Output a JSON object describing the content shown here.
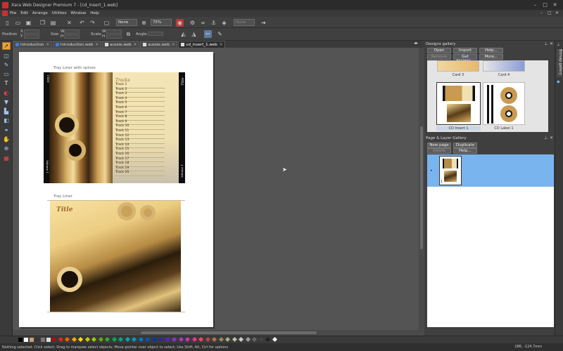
{
  "window": {
    "title": "Xara Web Designer Premium 7 - [cd_insert_1.web]"
  },
  "menu": [
    "File",
    "Edit",
    "Arrange",
    "Utilities",
    "Window",
    "Help"
  ],
  "toolbar": {
    "quality_value": "None",
    "zoom_value": "75%",
    "transparency_value": "None"
  },
  "infobar": {
    "position_label": "Position",
    "size_label": "Size",
    "scale_label": "Scale",
    "angle_label": "Angle",
    "x_label": "X",
    "y_label": "Y",
    "w_label": "W",
    "h_label": "H"
  },
  "tabs": [
    {
      "label": "Introduction",
      "active": false
    },
    {
      "label": "Introduction.web",
      "active": false
    },
    {
      "label": "aussie.web",
      "active": false
    },
    {
      "label": "aussie.web",
      "active": false
    },
    {
      "label": "cd_insert_1.web",
      "active": true
    }
  ],
  "document": {
    "spine_caption": "Tray Liner with spines",
    "spine_left_text": "Title",
    "spine_left_bottom": "Volume 1",
    "spine_right_text": "Title",
    "spine_right_bottom": "Volume 1",
    "tracks_heading": "Tracks",
    "tracks": [
      "Track 1",
      "Track 2",
      "Track 3",
      "Track 4",
      "Track 5",
      "Track 6",
      "Track 7",
      "Track 8",
      "Track 9",
      "Track 10",
      "Track 11",
      "Track 12",
      "Track 13",
      "Track 14",
      "Track 15",
      "Track 16",
      "Track 17",
      "Track 18",
      "Track 19",
      "Track 20"
    ],
    "liner_caption": "Tray Liner",
    "liner_title": "Title"
  },
  "designs_gallery": {
    "title": "Designs gallery",
    "buttons": {
      "open": "Open",
      "import": "Import",
      "help": "Help...",
      "remove": "Remove",
      "get_designs": "Get designs...",
      "more": "More..."
    },
    "items": [
      {
        "label": "Card 3"
      },
      {
        "label": "Card 4"
      },
      {
        "label": "CD Insert 1"
      },
      {
        "label": "CD Label 1"
      }
    ]
  },
  "layer_gallery": {
    "title": "Page & Layer Gallery",
    "buttons": {
      "new_page": "New page",
      "duplicate": "Duplicate",
      "delete": "Delete",
      "help": "Help..."
    },
    "page_number": "1"
  },
  "side_tab": "Bitmap gallery",
  "status": {
    "text": "Nothing selected: Click select; Drag to marquee select objects; Move pointer over object to select; Use Shift, Alt, Ctrl for options",
    "coords": "286, -124.7mm"
  },
  "colors": {
    "accent": "#7ab4ee",
    "tool_selected": "#e8a23b",
    "app_red": "#c8312c"
  }
}
